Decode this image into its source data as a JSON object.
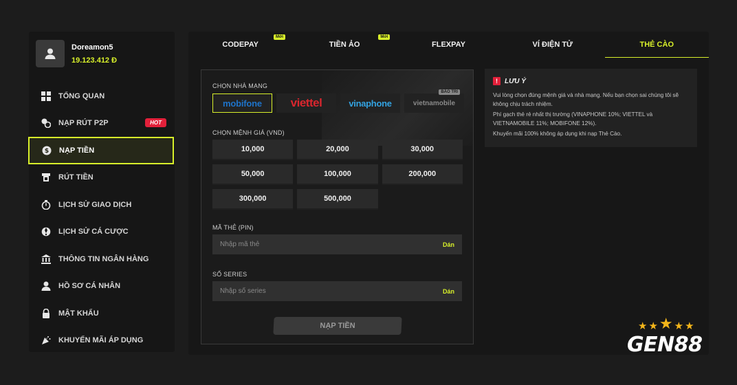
{
  "user": {
    "name": "Doreamon5",
    "balance": "19.123.412 Đ"
  },
  "sidebar": {
    "items": [
      {
        "label": "TỔNG QUAN",
        "icon": "grid-icon"
      },
      {
        "label": "NẠP RÚT P2P",
        "icon": "p2p-coins-icon",
        "badge": "HOT"
      },
      {
        "label": "NẠP TIỀN",
        "icon": "deposit-icon",
        "active": true
      },
      {
        "label": "RÚT TIỀN",
        "icon": "withdraw-icon"
      },
      {
        "label": "LỊCH SỬ GIAO DỊCH",
        "icon": "stopwatch-icon"
      },
      {
        "label": "LỊCH SỬ CÁ CƯỢC",
        "icon": "bet-history-icon"
      },
      {
        "label": "THÔNG TIN NGÂN HÀNG",
        "icon": "bank-icon"
      },
      {
        "label": "HỒ SƠ CÁ NHÂN",
        "icon": "user-icon"
      },
      {
        "label": "MẬT KHẨU",
        "icon": "lock-icon"
      },
      {
        "label": "KHUYẾN MÃI ÁP DỤNG",
        "icon": "gift-icon"
      }
    ]
  },
  "tabs": [
    {
      "label": "CODEPAY",
      "badge": "Mới"
    },
    {
      "label": "TIỀN ẢO",
      "badge": "Mới"
    },
    {
      "label": "FLEXPAY"
    },
    {
      "label": "VÍ ĐIỆN TỬ"
    },
    {
      "label": "THẺ CÀO",
      "active": true
    }
  ],
  "form": {
    "carrier_label": "CHỌN NHÀ MẠNG",
    "carriers": [
      {
        "name": "mobifone",
        "selected": true
      },
      {
        "name": "viettel"
      },
      {
        "name": "vinaphone"
      },
      {
        "name": "vietnamobile",
        "badge": "BẢO TRÌ"
      }
    ],
    "amount_label": "CHỌN MỆNH GIÁ (VND)",
    "amounts": [
      "10,000",
      "20,000",
      "30,000",
      "50,000",
      "100,000",
      "200,000",
      "300,000",
      "500,000"
    ],
    "pin_label": "MÃ THẺ (PIN)",
    "pin_placeholder": "Nhập mã thẻ",
    "serial_label": "SỐ SERIES",
    "serial_placeholder": "Nhập số series",
    "paste_label": "Dán",
    "submit_label": "NẠP TIỀN"
  },
  "note": {
    "title": "LƯU Ý",
    "icon": "exclamation-icon",
    "lines": [
      "Vui lòng chọn đúng mệnh giá và nhà mạng. Nếu bạn chọn sai chúng tôi sẽ không chịu trách nhiệm.",
      "Phí gạch thẻ rẻ nhất thị trường (VINAPHONE 10%; VIETTEL và VIETNAMOBILE 11%; MOBIFONE 12%).",
      "Khuyến mãi 100% không áp dụng khi nạp Thẻ Cào."
    ]
  },
  "brand": {
    "logo_text": "GEN88",
    "accent": "#d8f02a"
  },
  "colors": {
    "accent": "#d8f02a",
    "hot": "#e2203a",
    "background": "#1c1c1c"
  }
}
